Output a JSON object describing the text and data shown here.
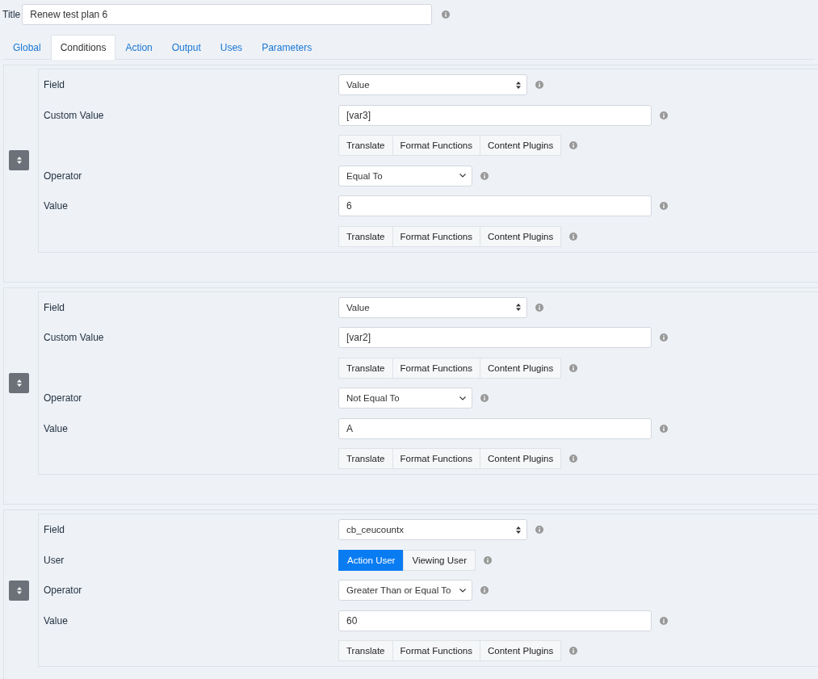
{
  "title": {
    "label": "Title",
    "value": "Renew test plan 6"
  },
  "tabs": [
    {
      "label": "Global",
      "selected": false
    },
    {
      "label": "Conditions",
      "selected": true
    },
    {
      "label": "Action",
      "selected": false
    },
    {
      "label": "Output",
      "selected": false
    },
    {
      "label": "Uses",
      "selected": false
    },
    {
      "label": "Parameters",
      "selected": false
    }
  ],
  "conditions": [
    {
      "rows": [
        {
          "kind": "select",
          "label": "Field",
          "value": "Value"
        },
        {
          "kind": "input",
          "label": "Custom Value",
          "value": "[var3]"
        },
        {
          "kind": "buttons",
          "buttons": [
            "Translate",
            "Format Functions",
            "Content Plugins"
          ]
        },
        {
          "kind": "dropdown",
          "label": "Operator",
          "value": "Equal To"
        },
        {
          "kind": "input",
          "label": "Value",
          "value": "6"
        },
        {
          "kind": "buttons",
          "buttons": [
            "Translate",
            "Format Functions",
            "Content Plugins"
          ]
        }
      ]
    },
    {
      "rows": [
        {
          "kind": "select",
          "label": "Field",
          "value": "Value"
        },
        {
          "kind": "input",
          "label": "Custom Value",
          "value": "[var2]"
        },
        {
          "kind": "buttons",
          "buttons": [
            "Translate",
            "Format Functions",
            "Content Plugins"
          ]
        },
        {
          "kind": "dropdown",
          "label": "Operator",
          "value": "Not Equal To"
        },
        {
          "kind": "input",
          "label": "Value",
          "value": "A"
        },
        {
          "kind": "buttons",
          "buttons": [
            "Translate",
            "Format Functions",
            "Content Plugins"
          ]
        }
      ]
    },
    {
      "rows": [
        {
          "kind": "select",
          "label": "Field",
          "value": "cb_ceucountx"
        },
        {
          "kind": "toggle",
          "label": "User",
          "options": [
            {
              "label": "Action User",
              "selected": true
            },
            {
              "label": "Viewing User",
              "selected": false
            }
          ]
        },
        {
          "kind": "dropdown",
          "label": "Operator",
          "value": "Greater Than or Equal To"
        },
        {
          "kind": "input",
          "label": "Value",
          "value": "60"
        },
        {
          "kind": "buttons",
          "buttons": [
            "Translate",
            "Format Functions",
            "Content Plugins"
          ]
        }
      ]
    }
  ]
}
